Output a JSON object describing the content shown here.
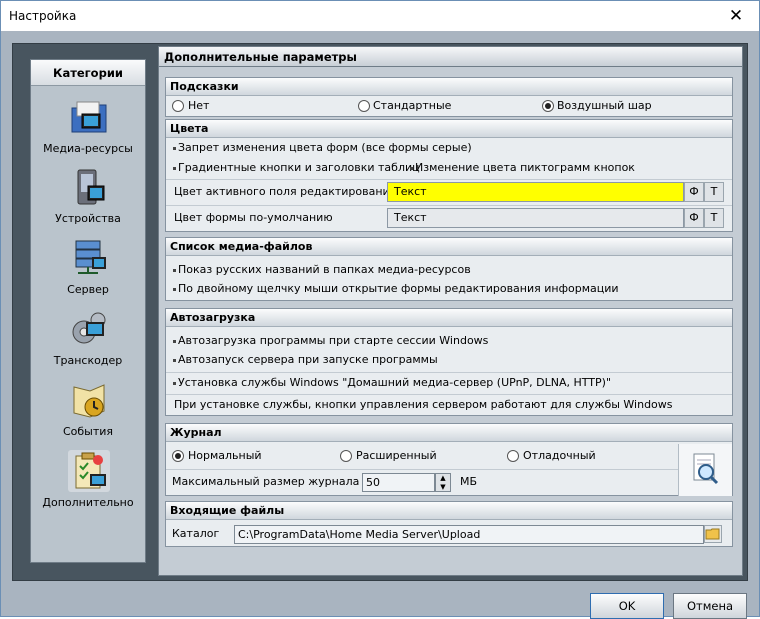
{
  "window": {
    "title": "Настройка",
    "close_glyph": "✕"
  },
  "categories": {
    "header": "Категории",
    "items": [
      {
        "label": "Медиа-ресурсы",
        "icon": "media-folder-icon"
      },
      {
        "label": "Устройства",
        "icon": "devices-icon"
      },
      {
        "label": "Сервер",
        "icon": "server-icon"
      },
      {
        "label": "Транскодер",
        "icon": "transcoder-icon"
      },
      {
        "label": "События",
        "icon": "events-icon"
      },
      {
        "label": "Дополнительно",
        "icon": "advanced-icon",
        "selected": true
      }
    ]
  },
  "main": {
    "title": "Дополнительные параметры",
    "hints": {
      "title": "Подсказки",
      "options": [
        "Нет",
        "Стандартные",
        "Воздушный шар"
      ],
      "selected": "Воздушный шар"
    },
    "colors": {
      "title": "Цвета",
      "item1": "Запрет изменения цвета форм (все формы серые)",
      "item2": "Градиентные кнопки и заголовки таблиц",
      "item3": "Изменение цвета пиктограмм кнопок",
      "active_label": "Цвет активного поля редактирования",
      "active_value": "Текст",
      "active_color": "#ffff00",
      "default_label": "Цвет формы по-умолчанию",
      "default_value": "Текст",
      "btn_f": "Ф",
      "btn_t": "Т"
    },
    "media": {
      "title": "Список медиа-файлов",
      "item1": "Показ русских названий в папках медиа-ресурсов",
      "item2": "По двойному щелчку мыши открытие формы редактирования информации"
    },
    "autoload": {
      "title": "Автозагрузка",
      "item1": "Автозагрузка программы при старте сессии Windows",
      "item2": "Автозапуск сервера при запуске программы",
      "item3": "Установка службы Windows \"Домашний медиа-сервер (UPnP, DLNA, HTTP)\"",
      "note": "При установке службы, кнопки управления сервером работают для службы Windows"
    },
    "log": {
      "title": "Журнал",
      "options": [
        "Нормальный",
        "Расширенный",
        "Отладочный"
      ],
      "selected": "Нормальный",
      "size_label": "Максимальный размер  журнала",
      "size_value": "50",
      "size_unit": "МБ"
    },
    "incoming": {
      "title": "Входящие файлы",
      "catalog_label": "Каталог",
      "catalog_value": "C:\\ProgramData\\Home Media Server\\Upload"
    }
  },
  "buttons": {
    "ok": "OK",
    "cancel": "Отмена"
  },
  "accent": "#2f6db0"
}
